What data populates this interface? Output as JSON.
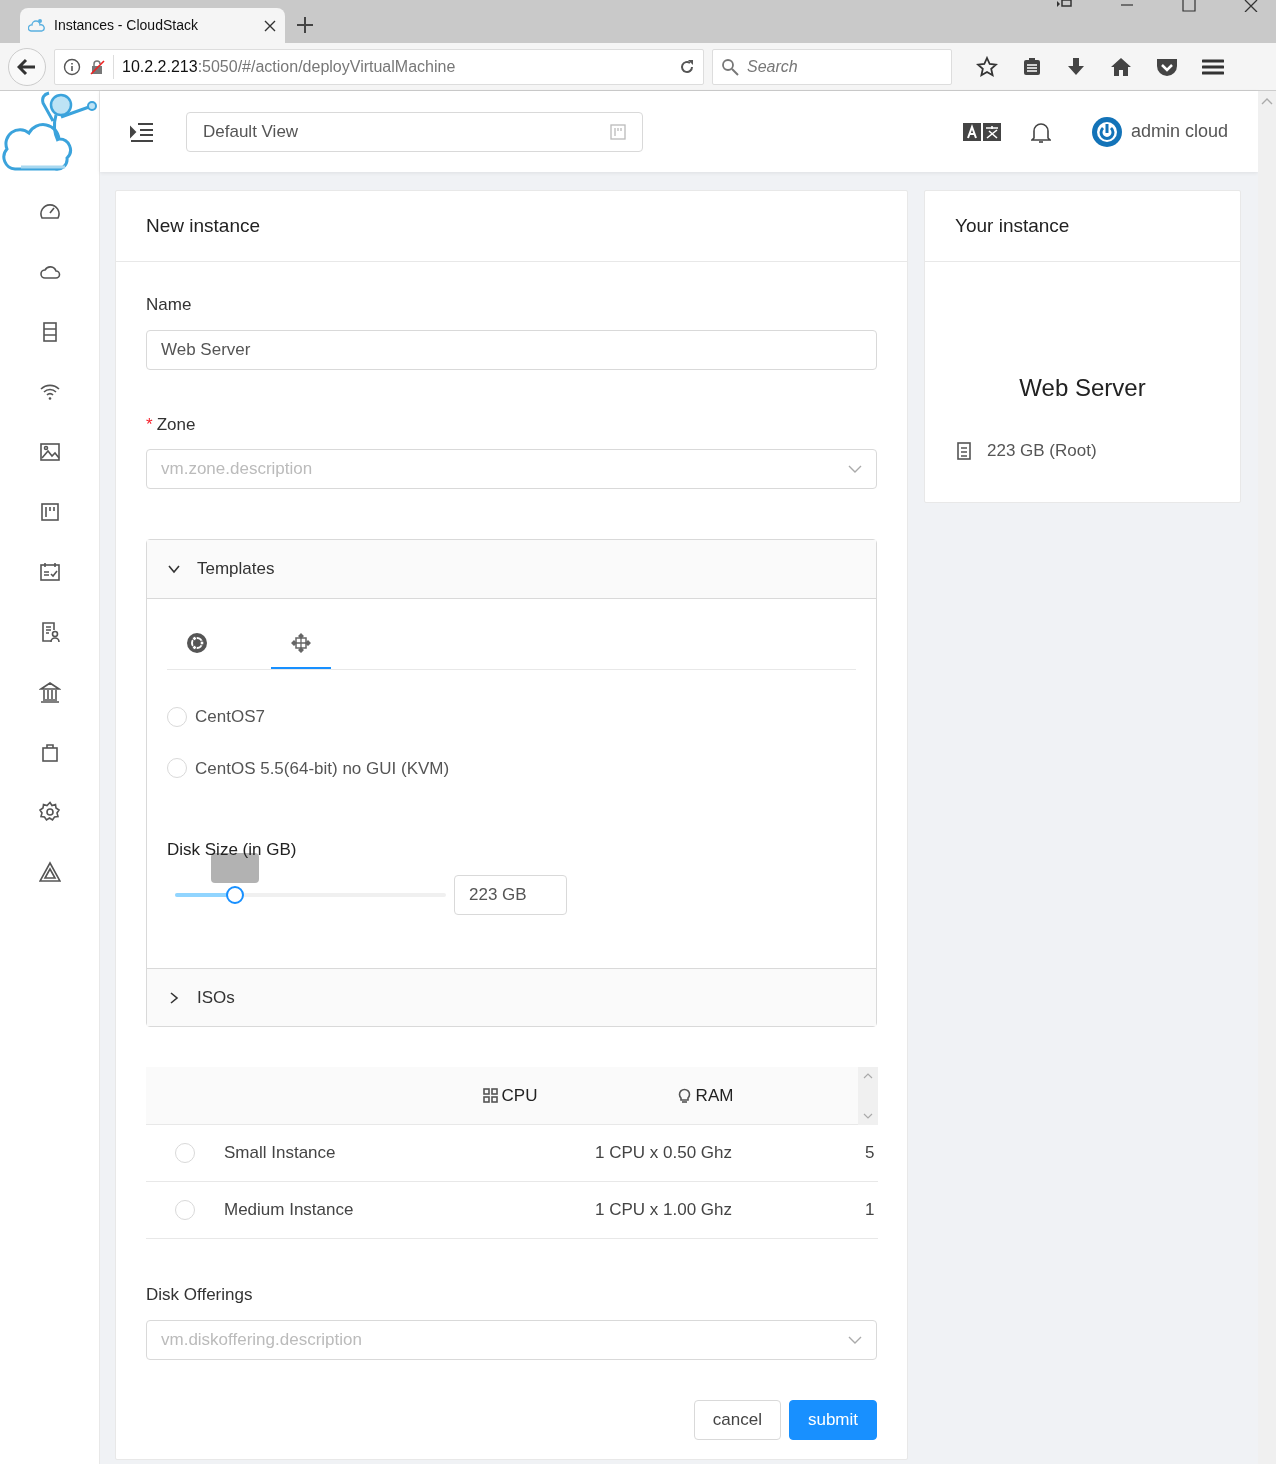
{
  "browser": {
    "tab_title": "Instances - CloudStack",
    "url_host": "10.2.2.213",
    "url_path": ":5050/#/action/deployVirtualMachine",
    "search_placeholder": "Search"
  },
  "header": {
    "view_select": "Default View",
    "user": "admin cloud"
  },
  "form": {
    "title": "New instance",
    "name": {
      "label": "Name",
      "value": "Web Server"
    },
    "zone": {
      "label": "Zone",
      "required_mark": "*",
      "placeholder": "vm.zone.description"
    },
    "sections": [
      {
        "title": "Templates",
        "expanded": true
      },
      {
        "title": "ISOs",
        "expanded": false
      }
    ],
    "template_tabs": [
      {
        "selected": false
      },
      {
        "selected": true
      }
    ],
    "templates": [
      {
        "label": "CentOS7",
        "selected": false
      },
      {
        "label": "CentOS 5.5(64-bit) no GUI (KVM)",
        "selected": false
      }
    ],
    "disk_size": {
      "label": "Disk Size (in GB)",
      "level": 0.22,
      "value": "223 GB"
    },
    "offerings": {
      "columns": [
        {
          "label": "CPU"
        },
        {
          "label": "RAM"
        }
      ],
      "rows": [
        {
          "name": "Small Instance",
          "cpu": "1 CPU x 0.50 Ghz",
          "ram": "5",
          "selected": false
        },
        {
          "name": "Medium Instance",
          "cpu": "1 CPU x 1.00 Ghz",
          "ram": "1",
          "selected": false
        }
      ]
    },
    "disk_offerings": {
      "label": "Disk Offerings",
      "placeholder": "vm.diskoffering.description"
    },
    "buttons": {
      "cancel": "cancel",
      "submit": "submit"
    }
  },
  "summary": {
    "title": "Your instance",
    "name": "Web Server",
    "disk": "223 GB (Root)"
  }
}
